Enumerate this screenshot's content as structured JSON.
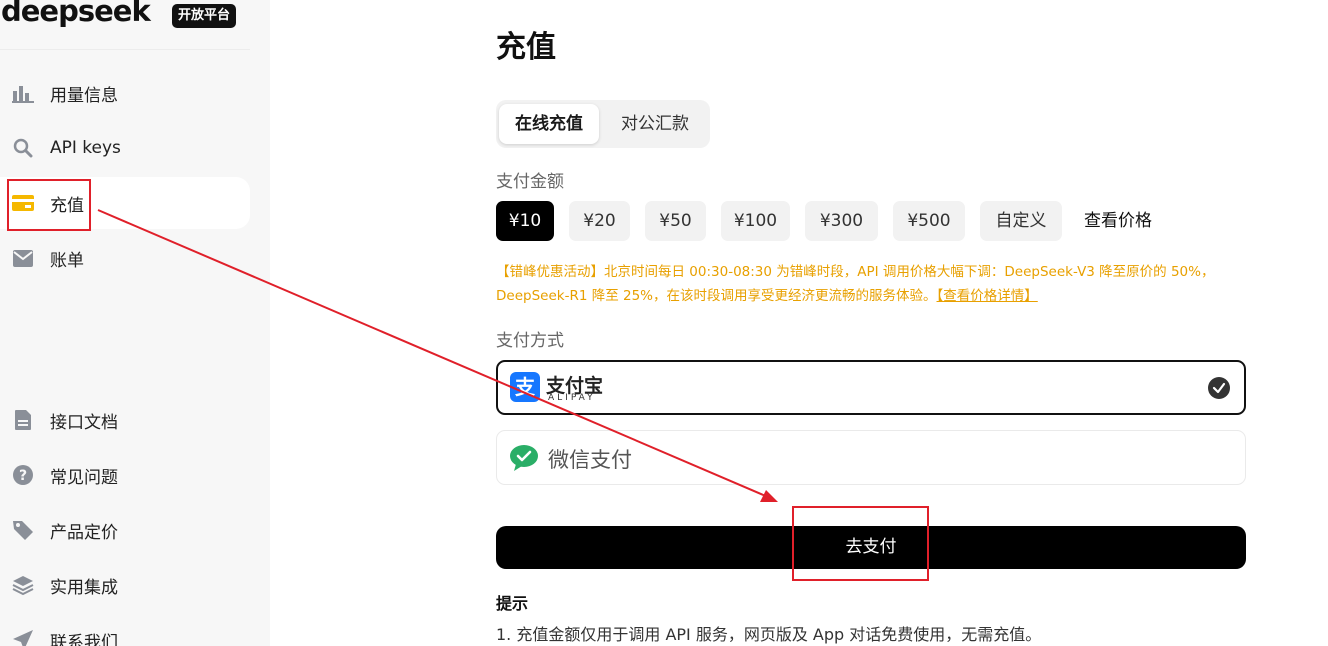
{
  "brand": {
    "logo": "deepseek",
    "badge": "开放平台"
  },
  "sidebar": {
    "items": [
      {
        "label": "用量信息",
        "icon": "bar-chart-icon"
      },
      {
        "label": "API keys",
        "icon": "search-key-icon"
      },
      {
        "label": "充值",
        "icon": "card-icon",
        "active": true
      },
      {
        "label": "账单",
        "icon": "bill-icon"
      },
      {
        "label": "接口文档",
        "icon": "doc-icon"
      },
      {
        "label": "常见问题",
        "icon": "question-icon"
      },
      {
        "label": "产品定价",
        "icon": "tag-icon"
      },
      {
        "label": "实用集成",
        "icon": "layers-icon"
      },
      {
        "label": "联系我们",
        "icon": "send-icon"
      }
    ]
  },
  "main": {
    "title": "充值",
    "tabs": [
      {
        "label": "在线充值",
        "active": true
      },
      {
        "label": "对公汇款",
        "active": false
      }
    ],
    "amount_label": "支付金额",
    "amounts": [
      "¥10",
      "¥20",
      "¥50",
      "¥100",
      "¥300",
      "¥500",
      "自定义"
    ],
    "selected_amount": "¥10",
    "price_link": "查看价格",
    "promo_text": "【错峰优惠活动】北京时间每日 00:30-08:30 为错峰时段，API 调用价格大幅下调：DeepSeek-V3 降至原价的 50%，DeepSeek-R1 降至 25%，在该时段调用享受更经济更流畅的服务体验。",
    "promo_link": "【查看价格详情】",
    "method_label": "支付方式",
    "alipay": {
      "cn": "支付宝",
      "en": "ALIPAY",
      "selected": true
    },
    "wechat": {
      "label": "微信支付",
      "selected": false
    },
    "pay_button": "去支付",
    "tips_title": "提示",
    "tips": [
      "1. 充值金额仅用于调用 API 服务，网页版及 App 对话免费使用，无需充值。"
    ]
  },
  "colors": {
    "accent": "#000000",
    "promo": "#e8a000",
    "active_nav_icon": "#f5b800",
    "annotation": "#e0202a",
    "alipay_blue": "#1677ff",
    "wechat_green": "#2aae67"
  }
}
